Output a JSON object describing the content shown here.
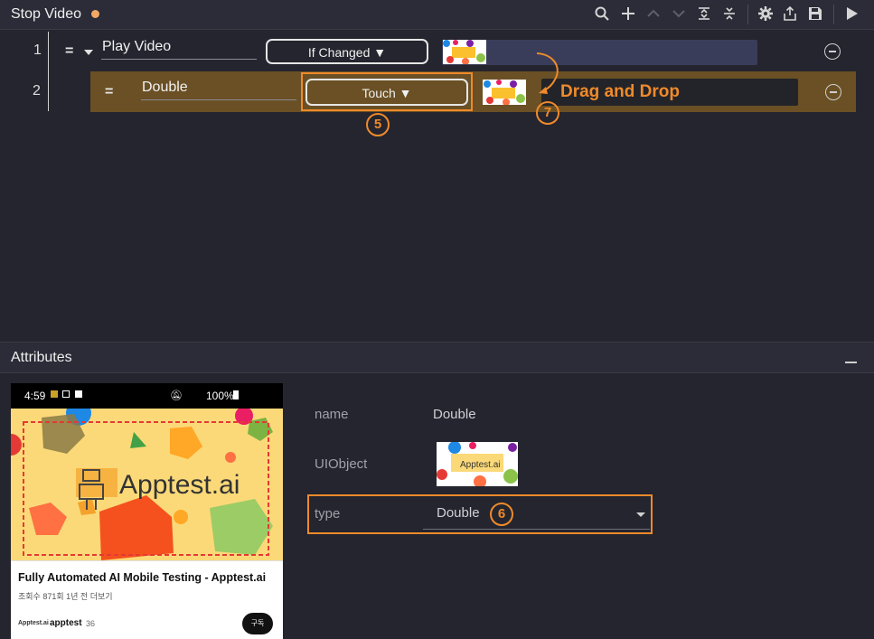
{
  "toolbar": {
    "title": "Stop Video",
    "icons": [
      "search-icon",
      "add-icon",
      "move-up-icon",
      "move-down-icon",
      "expand-all-icon",
      "collapse-all-icon",
      "settings-icon",
      "export-icon",
      "save-icon",
      "play-icon"
    ]
  },
  "steps": [
    {
      "number": "1",
      "eq": "=",
      "name": "Play Video",
      "condition": "If Changed ▼"
    },
    {
      "number": "2",
      "eq": "=",
      "name": "Double",
      "action": "Touch ▼"
    }
  ],
  "annotations": {
    "drag_drop": "Drag and Drop",
    "num5": "5",
    "num6": "6",
    "num7": "7"
  },
  "attributes": {
    "title": "Attributes",
    "fields": [
      {
        "label": "name",
        "value": "Double"
      },
      {
        "label": "UIObject",
        "value": ""
      },
      {
        "label": "type",
        "value": "Double"
      }
    ]
  },
  "phone": {
    "time": "4:59",
    "status_right": "100%",
    "banner_text": "Apptest.ai",
    "video_title": "Fully Automated AI Mobile Testing - Apptest.ai",
    "video_meta": "조회수 871회  1년 전  더보기",
    "channel_logo": "Apptest.ai",
    "channel_name": "apptest",
    "channel_subs": "36",
    "subscribe": "구독"
  },
  "colors": {
    "accent": "#ef8a2b",
    "row_highlight": "#6a5024",
    "unsaved_dot": "#f3a766"
  }
}
